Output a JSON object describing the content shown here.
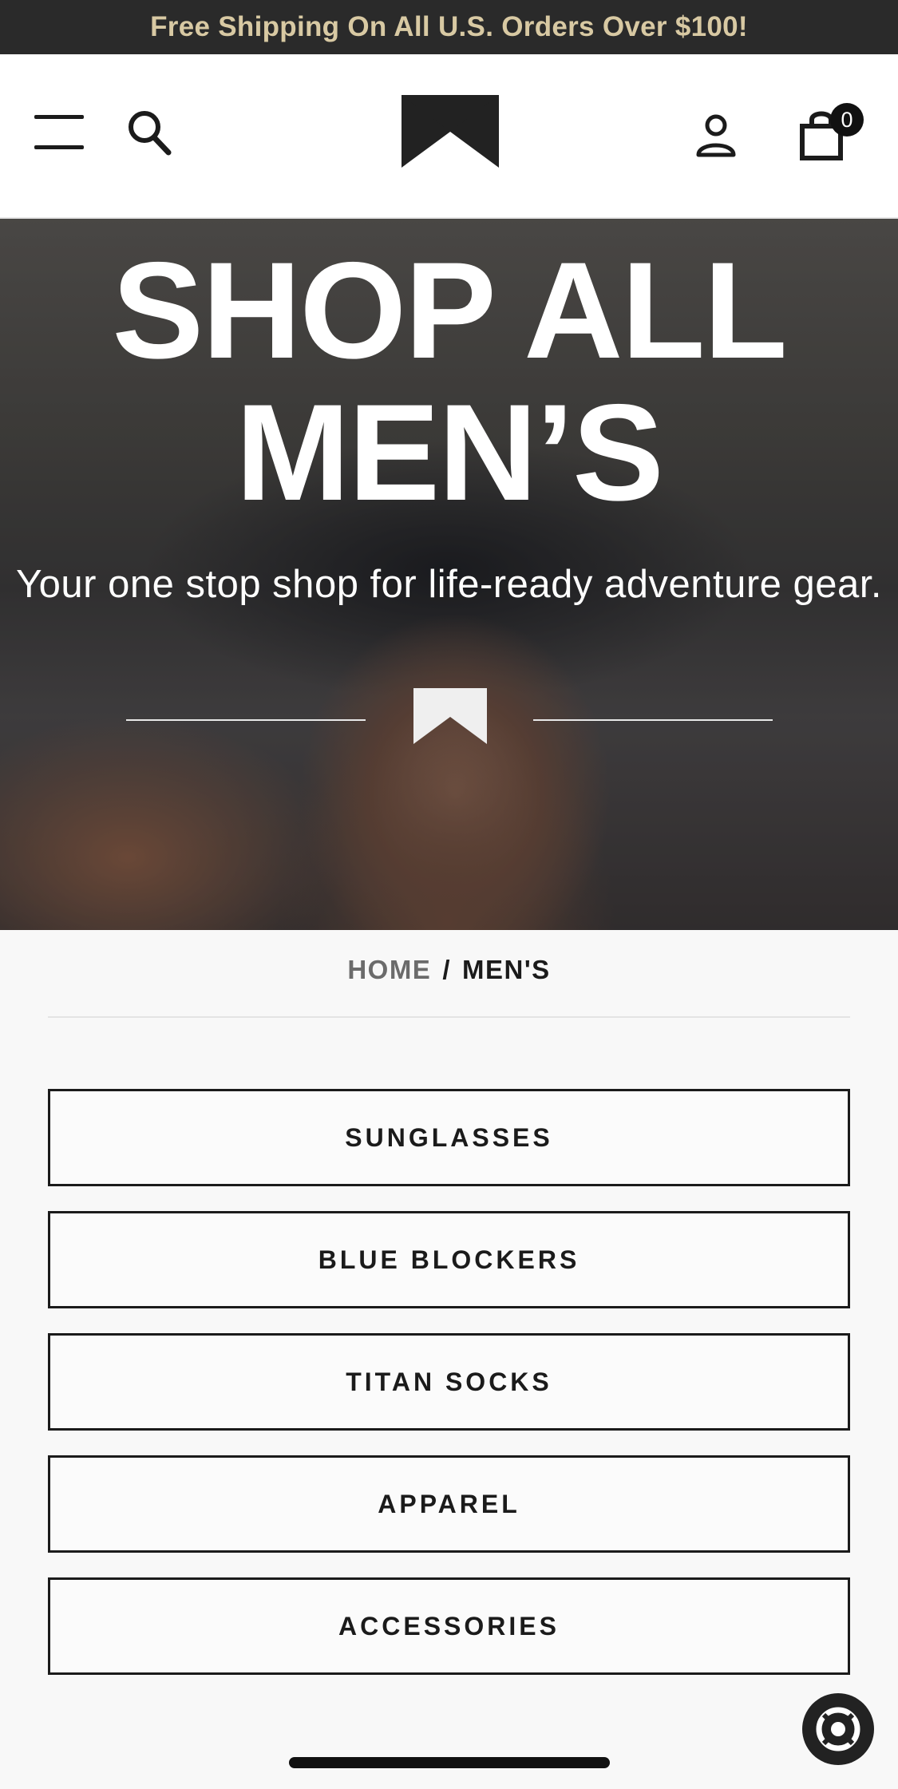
{
  "announcement": {
    "text": "Free Shipping On All U.S. Orders Over $100!"
  },
  "header": {
    "menu_icon": "hamburger-menu-icon",
    "search_icon": "search-icon",
    "logo": "bowtie-logo",
    "account_icon": "account-icon",
    "cart_icon": "shopping-bag-icon",
    "cart_count": "0"
  },
  "hero": {
    "title_line1": "SHOP ALL",
    "title_line2": "MEN’S",
    "subtitle": "Your one stop shop for life-ready adventure gear."
  },
  "breadcrumb": {
    "home": "HOME",
    "separator": "/",
    "current": "MEN'S"
  },
  "categories": [
    {
      "label": "SUNGLASSES"
    },
    {
      "label": "BLUE BLOCKERS"
    },
    {
      "label": "TITAN SOCKS"
    },
    {
      "label": "APPAREL"
    },
    {
      "label": "ACCESSORIES"
    }
  ],
  "chat": {
    "icon": "chat-support-icon"
  },
  "colors": {
    "announcement_bg": "#2a2a2a",
    "announcement_text": "#d8c9a3",
    "text": "#1b1b1b",
    "page_bg": "#f8f8f8"
  }
}
